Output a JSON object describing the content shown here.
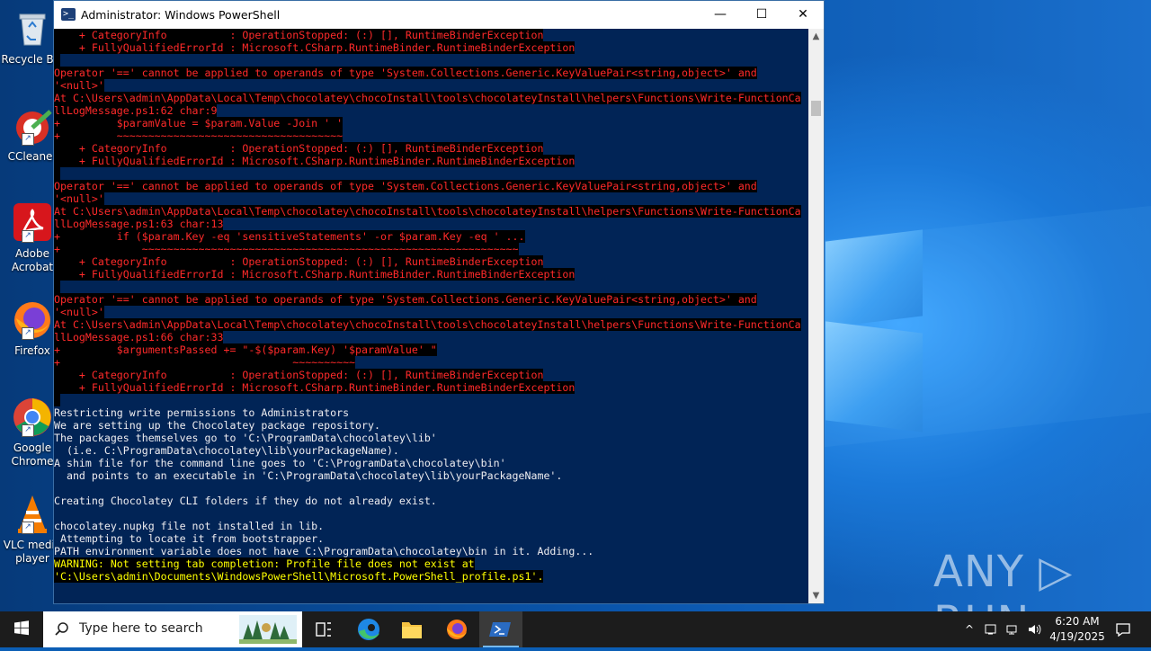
{
  "window": {
    "title": "Administrator: Windows PowerShell",
    "minimize_glyph": "—",
    "maximize_glyph": "☐",
    "close_glyph": "✕"
  },
  "console_lines": [
    {
      "t": "    + CategoryInfo          : OperationStopped: (:) [], RuntimeBinderException",
      "s": "err"
    },
    {
      "t": "    + FullyQualifiedErrorId : Microsoft.CSharp.RuntimeBinder.RuntimeBinderException",
      "s": "err"
    },
    {
      "t": "",
      "s": "err"
    },
    {
      "t": "Operator '==' cannot be applied to operands of type 'System.Collections.Generic.KeyValuePair<string,object>' and",
      "s": "err"
    },
    {
      "t": "'<null>'",
      "s": "err"
    },
    {
      "t": "At C:\\Users\\admin\\AppData\\Local\\Temp\\chocolatey\\chocoInstall\\tools\\chocolateyInstall\\helpers\\Functions\\Write-FunctionCa",
      "s": "err"
    },
    {
      "t": "llLogMessage.ps1:62 char:9",
      "s": "err"
    },
    {
      "t": "+         $paramValue = $param.Value -Join ' '",
      "s": "err"
    },
    {
      "t": "+         ~~~~~~~~~~~~~~~~~~~~~~~~~~~~~~~~~~~~",
      "s": "err"
    },
    {
      "t": "    + CategoryInfo          : OperationStopped: (:) [], RuntimeBinderException",
      "s": "err"
    },
    {
      "t": "    + FullyQualifiedErrorId : Microsoft.CSharp.RuntimeBinder.RuntimeBinderException",
      "s": "err"
    },
    {
      "t": "",
      "s": "err"
    },
    {
      "t": "Operator '==' cannot be applied to operands of type 'System.Collections.Generic.KeyValuePair<string,object>' and",
      "s": "err"
    },
    {
      "t": "'<null>'",
      "s": "err"
    },
    {
      "t": "At C:\\Users\\admin\\AppData\\Local\\Temp\\chocolatey\\chocoInstall\\tools\\chocolateyInstall\\helpers\\Functions\\Write-FunctionCa",
      "s": "err"
    },
    {
      "t": "llLogMessage.ps1:63 char:13",
      "s": "err"
    },
    {
      "t": "+         if ($param.Key -eq 'sensitiveStatements' -or $param.Key -eq ' ...",
      "s": "err"
    },
    {
      "t": "+             ~~~~~~~~~~~~~~~~~~~~~~~~~~~~~~~~~~~~~~~~~~~~~~~~~~~~~~~~~~~~",
      "s": "err"
    },
    {
      "t": "    + CategoryInfo          : OperationStopped: (:) [], RuntimeBinderException",
      "s": "err"
    },
    {
      "t": "    + FullyQualifiedErrorId : Microsoft.CSharp.RuntimeBinder.RuntimeBinderException",
      "s": "err"
    },
    {
      "t": "",
      "s": "err"
    },
    {
      "t": "Operator '==' cannot be applied to operands of type 'System.Collections.Generic.KeyValuePair<string,object>' and",
      "s": "err"
    },
    {
      "t": "'<null>'",
      "s": "err"
    },
    {
      "t": "At C:\\Users\\admin\\AppData\\Local\\Temp\\chocolatey\\chocoInstall\\tools\\chocolateyInstall\\helpers\\Functions\\Write-FunctionCa",
      "s": "err"
    },
    {
      "t": "llLogMessage.ps1:66 char:33",
      "s": "err"
    },
    {
      "t": "+         $argumentsPassed += \"-$($param.Key) '$paramValue' \"",
      "s": "err"
    },
    {
      "t": "+                                     ~~~~~~~~~~",
      "s": "err"
    },
    {
      "t": "    + CategoryInfo          : OperationStopped: (:) [], RuntimeBinderException",
      "s": "err"
    },
    {
      "t": "    + FullyQualifiedErrorId : Microsoft.CSharp.RuntimeBinder.RuntimeBinderException",
      "s": "err"
    },
    {
      "t": "",
      "s": "err"
    },
    {
      "t": "Restricting write permissions to Administrators",
      "s": "norm"
    },
    {
      "t": "We are setting up the Chocolatey package repository.",
      "s": "norm"
    },
    {
      "t": "The packages themselves go to 'C:\\ProgramData\\chocolatey\\lib'",
      "s": "norm"
    },
    {
      "t": "  (i.e. C:\\ProgramData\\chocolatey\\lib\\yourPackageName).",
      "s": "norm"
    },
    {
      "t": "A shim file for the command line goes to 'C:\\ProgramData\\chocolatey\\bin'",
      "s": "norm"
    },
    {
      "t": "  and points to an executable in 'C:\\ProgramData\\chocolatey\\lib\\yourPackageName'.",
      "s": "norm"
    },
    {
      "t": "",
      "s": "norm"
    },
    {
      "t": "Creating Chocolatey CLI folders if they do not already exist.",
      "s": "norm"
    },
    {
      "t": "",
      "s": "norm"
    },
    {
      "t": "chocolatey.nupkg file not installed in lib.",
      "s": "norm"
    },
    {
      "t": " Attempting to locate it from bootstrapper.",
      "s": "norm"
    },
    {
      "t": "PATH environment variable does not have C:\\ProgramData\\chocolatey\\bin in it. Adding...",
      "s": "norm"
    },
    {
      "t": "WARNING: Not setting tab completion: Profile file does not exist at",
      "s": "warn"
    },
    {
      "t": "'C:\\Users\\admin\\Documents\\WindowsPowerShell\\Microsoft.PowerShell_profile.ps1'.",
      "s": "warn"
    }
  ],
  "desktop_icons": [
    {
      "name": "recycle-bin",
      "label": "Recycle Bin",
      "icon": "recycle-bin-icon"
    },
    {
      "name": "ccleaner",
      "label": "CCleaner",
      "icon": "ccleaner-icon"
    },
    {
      "name": "adobe-acrobat",
      "label": "Adobe\nAcrobat",
      "icon": "adobe-acrobat-icon"
    },
    {
      "name": "firefox",
      "label": "Firefox",
      "icon": "firefox-icon"
    },
    {
      "name": "google-chrome",
      "label": "Google\nChrome",
      "icon": "chrome-icon"
    },
    {
      "name": "vlc",
      "label": "VLC media\nplayer",
      "icon": "vlc-icon"
    }
  ],
  "watermark": "ANY ▷ RUN",
  "taskbar": {
    "search_placeholder": "Type here to search",
    "apps": [
      "task-view-icon",
      "edge-icon",
      "file-explorer-icon",
      "firefox-icon",
      "powershell-icon"
    ],
    "clock_time": "6:20 AM",
    "clock_date": "4/19/2025"
  },
  "colors": {
    "console_bg": "#012456",
    "error_fg": "#ff2a2a",
    "warning_fg": "#ffff00",
    "text_fg": "#eeedf0"
  }
}
